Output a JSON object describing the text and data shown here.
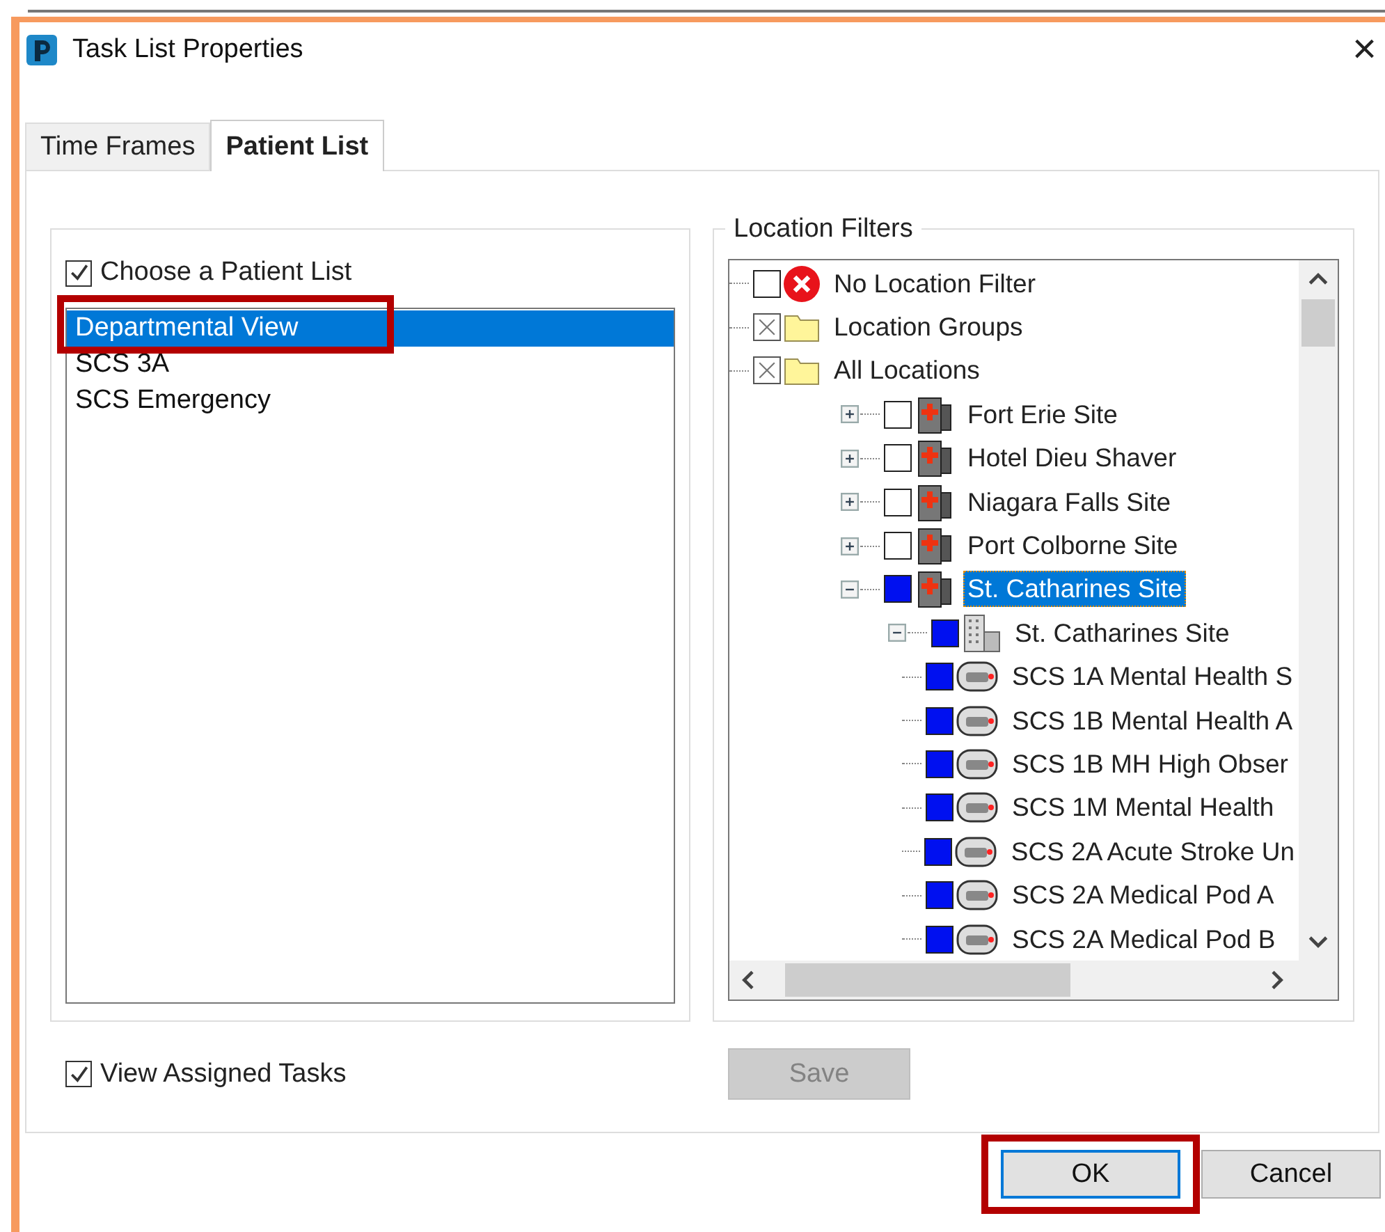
{
  "window": {
    "title": "Task List Properties",
    "close": "×"
  },
  "tabs": [
    {
      "label": "Time Frames",
      "selected": false
    },
    {
      "label": "Patient List",
      "selected": true
    }
  ],
  "patient_list": {
    "choose": {
      "label": "Choose a Patient List",
      "checked": true
    },
    "items": [
      {
        "label": "Departmental View",
        "selected": true,
        "highlighted": true
      },
      {
        "label": "SCS 3A",
        "selected": false,
        "highlighted": false
      },
      {
        "label": "SCS Emergency",
        "selected": false,
        "highlighted": false
      }
    ]
  },
  "location_filters": {
    "title": "Location Filters",
    "tree": [
      {
        "label": "No Location Filter",
        "kind": "error",
        "checked": false,
        "selected": false
      },
      {
        "label": "Location Groups",
        "kind": "folder",
        "crossed": true,
        "selected": false
      },
      {
        "label": "All Locations",
        "kind": "folder",
        "crossed": true,
        "selected": false,
        "children": [
          {
            "label": "Fort Erie Site",
            "kind": "hospital",
            "checked": false,
            "expanded": false,
            "selected": false
          },
          {
            "label": "Hotel Dieu Shaver",
            "kind": "hospital",
            "checked": false,
            "expanded": false,
            "selected": false
          },
          {
            "label": "Niagara Falls Site",
            "kind": "hospital",
            "checked": false,
            "expanded": false,
            "selected": false
          },
          {
            "label": "Port Colborne Site",
            "kind": "hospital",
            "checked": false,
            "expanded": false,
            "selected": false
          },
          {
            "label": "St. Catharines Site",
            "kind": "hospital",
            "checked": true,
            "expanded": true,
            "selected": true,
            "children": [
              {
                "label": "St. Catharines Site",
                "kind": "building",
                "checked": true,
                "expanded": true,
                "selected": false,
                "children": [
                  {
                    "label": "SCS 1A Mental Health S",
                    "kind": "unit",
                    "checked": true,
                    "selected": false
                  },
                  {
                    "label": "SCS 1B Mental Health A",
                    "kind": "unit",
                    "checked": true,
                    "selected": false
                  },
                  {
                    "label": "SCS 1B MH High Obser",
                    "kind": "unit",
                    "checked": true,
                    "selected": false
                  },
                  {
                    "label": "SCS 1M Mental Health",
                    "kind": "unit",
                    "checked": true,
                    "selected": false
                  },
                  {
                    "label": "SCS 2A Acute Stroke Un",
                    "kind": "unit",
                    "checked": true,
                    "selected": false
                  },
                  {
                    "label": "SCS 2A Medical Pod A",
                    "kind": "unit",
                    "checked": true,
                    "selected": false
                  },
                  {
                    "label": "SCS 2A Medical Pod B",
                    "kind": "unit",
                    "checked": true,
                    "selected": false
                  }
                ]
              }
            ]
          }
        ]
      }
    ]
  },
  "view_assigned": {
    "label": "View Assigned Tasks",
    "checked": true
  },
  "save_button": {
    "label": "Save",
    "disabled": true
  },
  "buttons": [
    {
      "label": "OK",
      "default": true,
      "highlighted": true
    },
    {
      "label": "Cancel",
      "default": false,
      "highlighted": false
    }
  ]
}
